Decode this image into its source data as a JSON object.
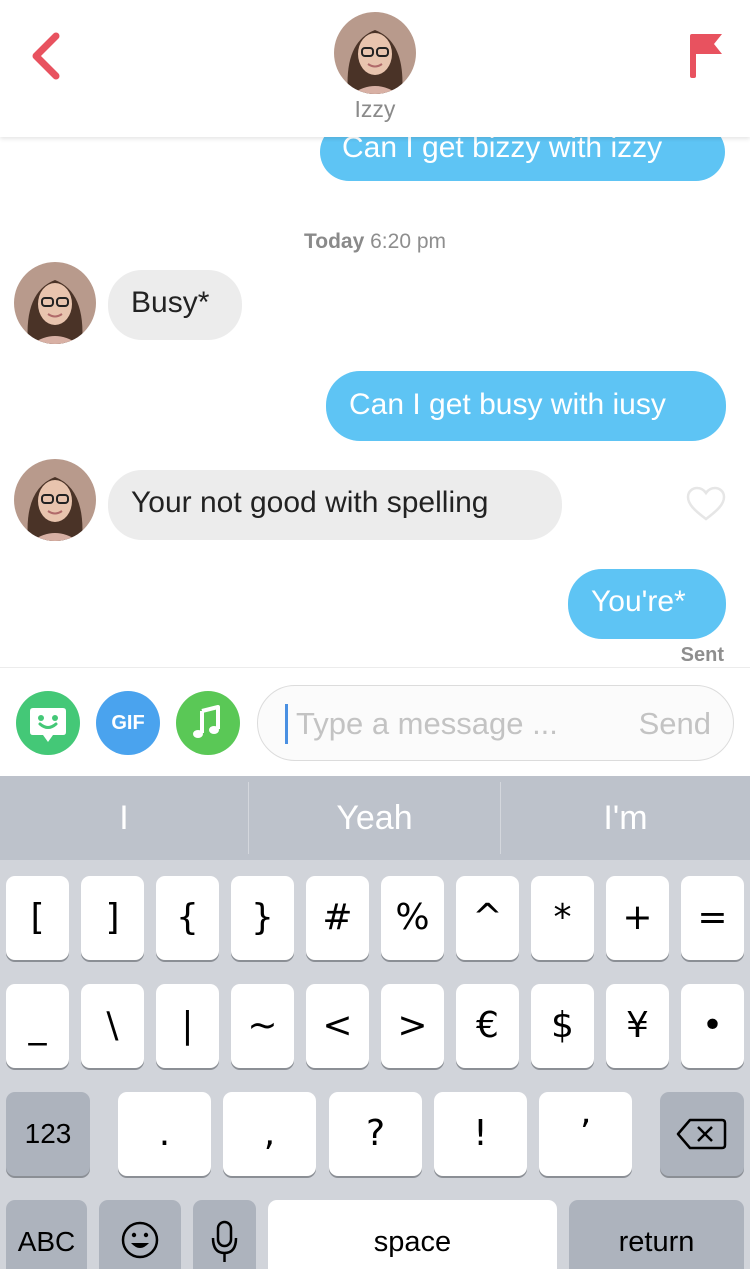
{
  "header": {
    "name": "Izzy",
    "accent_color": "#e8525f"
  },
  "chat": {
    "messages": [
      {
        "direction": "outgoing",
        "text": "Can I get bizzy with izzy"
      },
      {
        "direction": "incoming",
        "text": "Busy*"
      },
      {
        "direction": "outgoing",
        "text": "Can I get busy with iusy"
      },
      {
        "direction": "incoming",
        "text": "Your not good with spelling"
      },
      {
        "direction": "outgoing",
        "text": "You're*"
      }
    ],
    "timestamp_day": "Today",
    "timestamp_time": "6:20 pm",
    "sent_status": "Sent"
  },
  "input": {
    "gif_label": "GIF",
    "placeholder": "Type a message ...",
    "send_label": "Send"
  },
  "keyboard": {
    "suggestions": [
      "I",
      "Yeah",
      "I'm"
    ],
    "row1": [
      "[",
      "]",
      "{",
      "}",
      "#",
      "%",
      "^",
      "*",
      "+",
      "="
    ],
    "row2": [
      "_",
      "\\",
      "|",
      "~",
      "<",
      ">",
      "€",
      "$",
      "¥",
      "•"
    ],
    "row3_mode": "123",
    "row3": [
      ".",
      ",",
      "?",
      "!",
      "’"
    ],
    "abc_label": "ABC",
    "space_label": "space",
    "return_label": "return"
  },
  "colors": {
    "outgoing_bubble": "#5ec4f4",
    "incoming_bubble": "#ececec",
    "bitmoji_button": "#44c877",
    "gif_button": "#4aa3ee",
    "music_button": "#5ac856",
    "keyboard_bg": "#d1d4da"
  }
}
